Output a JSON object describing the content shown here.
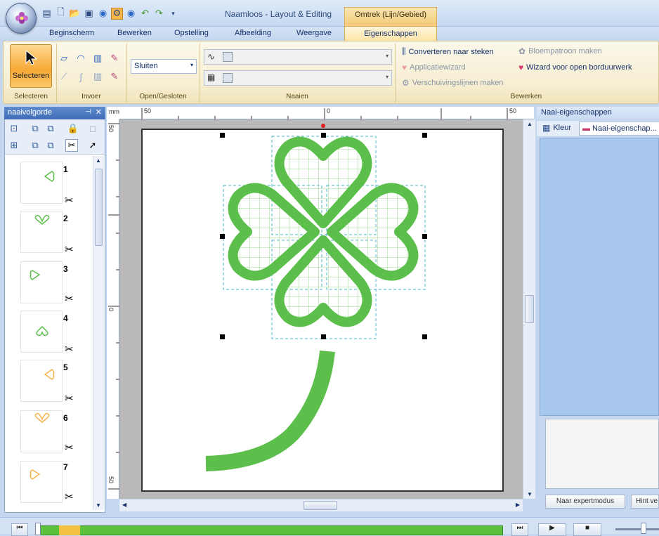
{
  "window": {
    "title": "Naamloos - Layout & Editing"
  },
  "qat": {
    "icons": [
      "layout-icon",
      "new-icon",
      "open-icon",
      "save-icon",
      "circle-icon",
      "gear-icon",
      "circle-icon",
      "undo-icon",
      "redo-icon"
    ]
  },
  "context_group": {
    "label": "Omtrek (Lijn/Gebied)"
  },
  "tabs": [
    {
      "label": "Beginscherm"
    },
    {
      "label": "Bewerken"
    },
    {
      "label": "Opstelling"
    },
    {
      "label": "Afbeelding"
    },
    {
      "label": "Weergave"
    },
    {
      "label": "Eigenschappen"
    }
  ],
  "ribbon": {
    "selecteren": {
      "button_label": "Selecteren",
      "group_label": "Selecteren"
    },
    "invoer": {
      "group_label": "Invoer"
    },
    "open_gesloten": {
      "combo_value": "Sluiten",
      "group_label": "Open/Gesloten"
    },
    "naaien": {
      "group_label": "Naaien"
    },
    "bewerken": {
      "group_label": "Bewerken",
      "items": [
        {
          "label": "Converteren naar steken",
          "enabled": true
        },
        {
          "label": "Applicatiewizard",
          "enabled": false
        },
        {
          "label": "Verschuivingslijnen maken",
          "enabled": false
        },
        {
          "label": "Bloempatroon maken",
          "enabled": false
        },
        {
          "label": "Wizard voor open borduurwerk",
          "enabled": true
        }
      ]
    }
  },
  "left_panel": {
    "title": "naaivolgorde",
    "items": [
      {
        "num": "1",
        "color": "#5cbf4b"
      },
      {
        "num": "2",
        "color": "#5cbf4b"
      },
      {
        "num": "3",
        "color": "#5cbf4b"
      },
      {
        "num": "4",
        "color": "#5cbf4b"
      },
      {
        "num": "5",
        "color": "#f4b44a"
      },
      {
        "num": "6",
        "color": "#f4b44a"
      },
      {
        "num": "7",
        "color": "#f4b44a"
      }
    ]
  },
  "rulers": {
    "top": [
      "50",
      "0",
      "50"
    ],
    "left": [
      "50",
      "0",
      "50"
    ]
  },
  "right_panel": {
    "title": "Naai-eigenschappen",
    "tab_kleur": "Kleur",
    "tab_naai": "Naai-eigenschap...",
    "button_expert": "Naar expertmodus",
    "button_hint": "Hint ve"
  },
  "colors": {
    "embroidery_green": "#5cbf4b",
    "ribbon_orange": "#f7a937"
  }
}
